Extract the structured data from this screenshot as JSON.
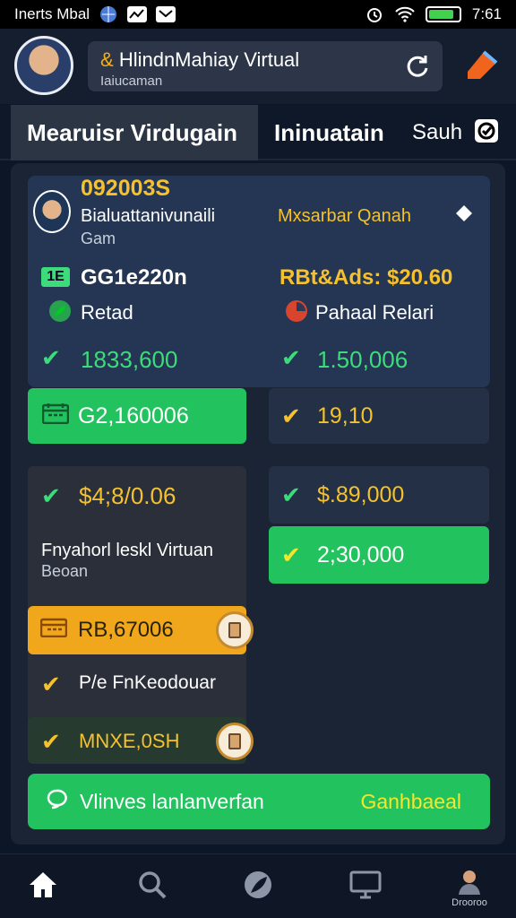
{
  "status_bar": {
    "carrier": "Inerts Mbal",
    "time": "7:61",
    "battery_level": 0.85
  },
  "header": {
    "search_title_prefix": "&",
    "search_title": "HlindnMahiay Virtual",
    "search_subtitle": "Iaiucaman"
  },
  "tabs": [
    {
      "label": "Mearuisr Virdugain",
      "active": true
    },
    {
      "label": "Ininuatain",
      "active": false
    },
    {
      "label": "Sauh",
      "active": false
    }
  ],
  "top_card": {
    "code": "092003S",
    "name_line1": "Bialuattanivunaili",
    "name_line2": "Gam",
    "right_label": "Mxsarbar Qanah",
    "left_stat_badge": "1E",
    "left_stat_label": "GG1e220n",
    "right_stat_label": "RBt&Ads: $20.60",
    "left_item": "Retad",
    "right_item": "Pahaal Relari",
    "left_value": "1833,600",
    "right_value": "1.50,006"
  },
  "row2": {
    "green_btn_value": "G2,160006",
    "right_value": "19,10"
  },
  "left_card": {
    "value": "$4;8/0.06",
    "text_line1": "Fnyahorl leskl Virtuan",
    "text_line2": "Beoan",
    "orange_value": "RB,67006",
    "option1": "P/e FnKeodouar",
    "option2": "MNXE,0SH"
  },
  "right_cards": {
    "value1": "$.89,000",
    "value2": "2;30,000"
  },
  "bottom_button": {
    "label": "Vlinves lanlanverfan",
    "action": "Ganhbaeal"
  },
  "nav": {
    "items": [
      "home-icon",
      "search-icon",
      "leaf-icon",
      "monitor-icon",
      "profile-icon"
    ],
    "profile_label": "Drooroo"
  },
  "colors": {
    "accent_green": "#22c35e",
    "accent_yellow": "#f5c12c",
    "accent_orange": "#f0a71c",
    "background": "#0d1626"
  }
}
